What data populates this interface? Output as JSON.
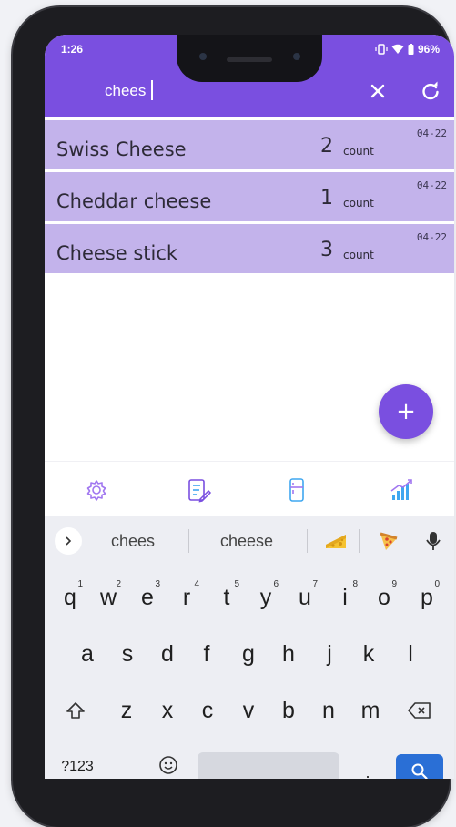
{
  "status": {
    "time": "1:26",
    "battery": "96%"
  },
  "search": {
    "query": "chees",
    "clear_icon": "close-icon",
    "refresh_icon": "refresh-icon"
  },
  "items": [
    {
      "name": "Swiss Cheese",
      "count": "2",
      "unit": "count",
      "date": "04-22"
    },
    {
      "name": "Cheddar cheese",
      "count": "1",
      "unit": "count",
      "date": "04-22"
    },
    {
      "name": "Cheese stick",
      "count": "3",
      "unit": "count",
      "date": "04-22"
    }
  ],
  "fab": {
    "label": "+"
  },
  "nav": [
    "settings-icon",
    "checklist-edit-icon",
    "fridge-icon",
    "chart-icon"
  ],
  "keyboard": {
    "suggestions": [
      "chees",
      "cheese"
    ],
    "emoji": [
      "cheese-emoji",
      "pizza-emoji"
    ],
    "row1": [
      "q",
      "w",
      "e",
      "r",
      "t",
      "y",
      "u",
      "i",
      "o",
      "p"
    ],
    "row1_hints": [
      "1",
      "2",
      "3",
      "4",
      "5",
      "6",
      "7",
      "8",
      "9",
      "0"
    ],
    "row2": [
      "a",
      "s",
      "d",
      "f",
      "g",
      "h",
      "j",
      "k",
      "l"
    ],
    "row3": [
      "z",
      "x",
      "c",
      "v",
      "b",
      "n",
      "m"
    ],
    "symbols": "?123",
    "comma": ",",
    "period": "."
  },
  "colors": {
    "accent": "#7a4fe0",
    "row_bg": "#c3b3eb",
    "keyboard_bg": "#edeef3",
    "search_key": "#2a6fd6"
  }
}
